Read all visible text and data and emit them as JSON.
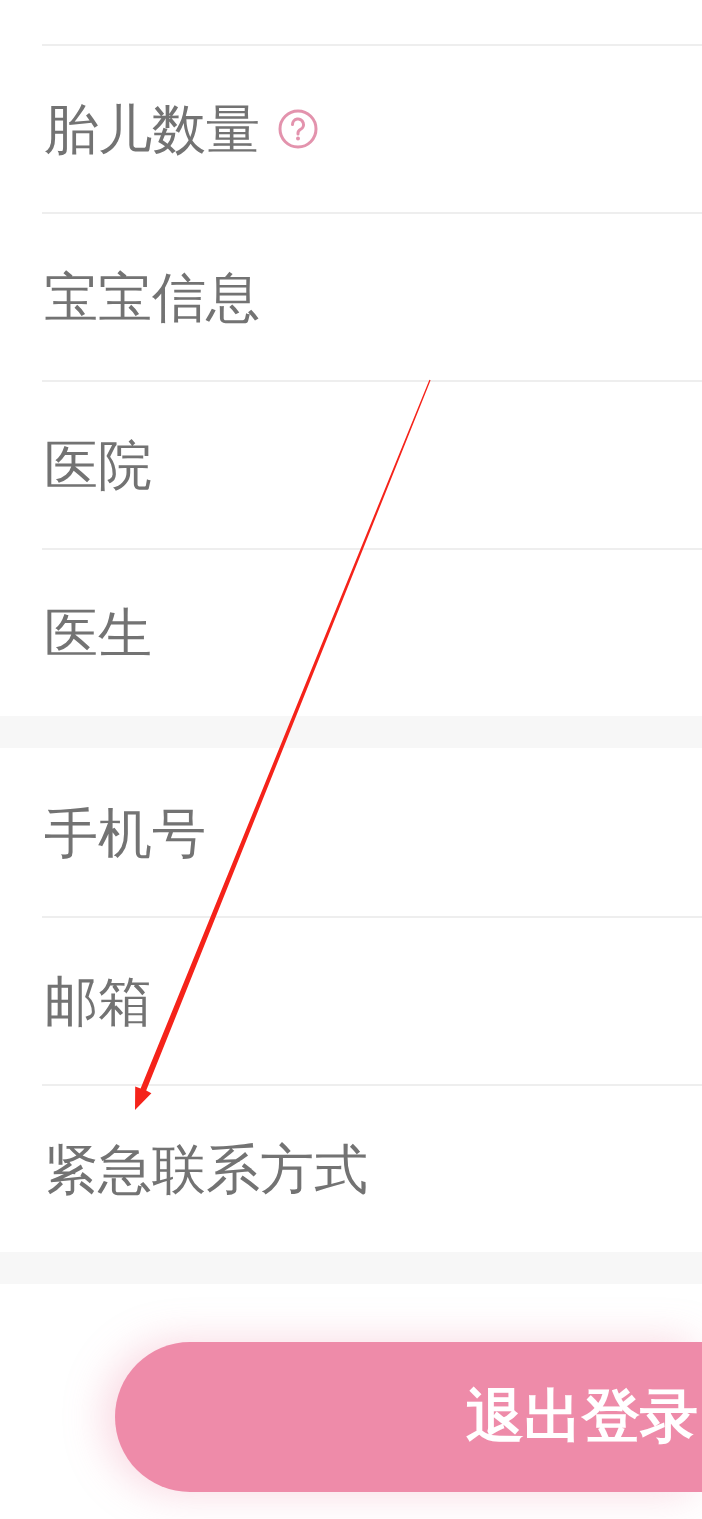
{
  "sections": [
    {
      "rows": [
        {
          "label": "胎儿数量",
          "help": true
        },
        {
          "label": "宝宝信息",
          "help": false
        },
        {
          "label": "医院",
          "help": false
        },
        {
          "label": "医生",
          "help": false
        }
      ]
    },
    {
      "rows": [
        {
          "label": "手机号",
          "help": false
        },
        {
          "label": "邮箱",
          "help": false
        },
        {
          "label": "紧急联系方式",
          "help": false
        }
      ]
    }
  ],
  "logout_button": {
    "label": "退出登录"
  },
  "annotation": {
    "kind": "arrow"
  }
}
